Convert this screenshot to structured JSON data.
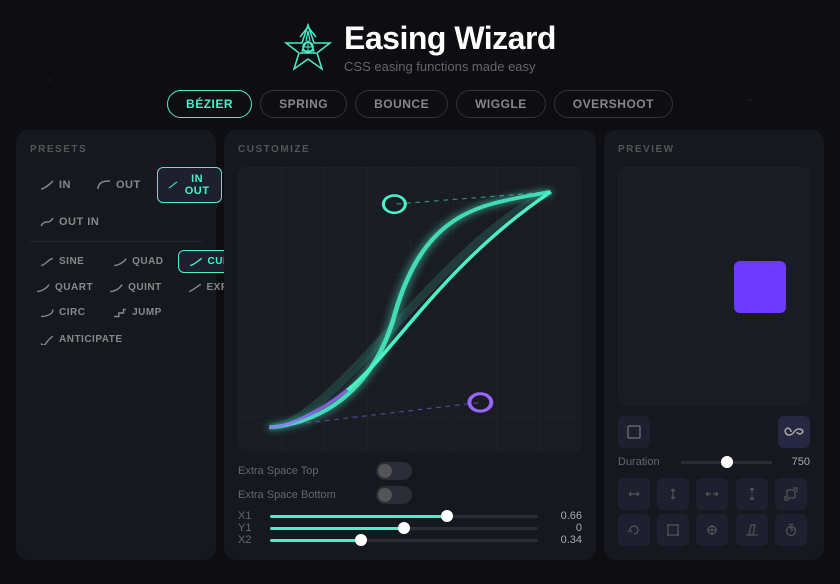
{
  "app": {
    "title": "Easing Wizard",
    "subtitle": "CSS easing functions made easy"
  },
  "tabs": [
    {
      "id": "bezier",
      "label": "BÉZIER",
      "active": true
    },
    {
      "id": "spring",
      "label": "SPRING",
      "active": false
    },
    {
      "id": "bounce",
      "label": "BOUNCE",
      "active": false
    },
    {
      "id": "wiggle",
      "label": "WIGGLE",
      "active": false
    },
    {
      "id": "overshoot",
      "label": "OVERSHOOT",
      "active": false
    }
  ],
  "presets": {
    "label": "PRESETS",
    "direction_buttons": [
      {
        "id": "in",
        "label": "IN",
        "active": false
      },
      {
        "id": "out",
        "label": "OUT",
        "active": false
      },
      {
        "id": "in-out",
        "label": "IN OUT",
        "active": true
      }
    ],
    "out_in": {
      "id": "out-in",
      "label": "OUT IN",
      "active": false
    },
    "easing_buttons": [
      {
        "id": "sine",
        "label": "SINE",
        "active": false
      },
      {
        "id": "quad",
        "label": "QUAD",
        "active": false
      },
      {
        "id": "cubic",
        "label": "CUBIC",
        "active": true
      },
      {
        "id": "quart",
        "label": "QUART",
        "active": false
      },
      {
        "id": "quint",
        "label": "QUINT",
        "active": false
      },
      {
        "id": "expo",
        "label": "EXPO",
        "active": false
      },
      {
        "id": "circ",
        "label": "CIRC",
        "active": false
      },
      {
        "id": "jump",
        "label": "JUMP",
        "active": false
      },
      {
        "id": "anticipate",
        "label": "ANTICIPATE",
        "active": false
      }
    ]
  },
  "customize": {
    "label": "CUSTOMIZE",
    "extra_space_top": {
      "label": "Extra Space Top",
      "enabled": false
    },
    "extra_space_bottom": {
      "label": "Extra Space Bottom",
      "enabled": false
    },
    "x1": {
      "label": "X1",
      "value": "0.66",
      "percent": 66
    },
    "y1": {
      "label": "Y1",
      "value": "0",
      "percent": 50
    },
    "x2": {
      "label": "X2",
      "value": "0.34",
      "percent": 34
    }
  },
  "preview": {
    "label": "PREVIEW",
    "duration": {
      "label": "Duration",
      "value": "750",
      "percent": 50
    },
    "icons": [
      "↔",
      "↕",
      "↔",
      "↕",
      "⊞",
      "⊙",
      "⊡",
      "⊕",
      "⊕",
      "⏱"
    ]
  }
}
